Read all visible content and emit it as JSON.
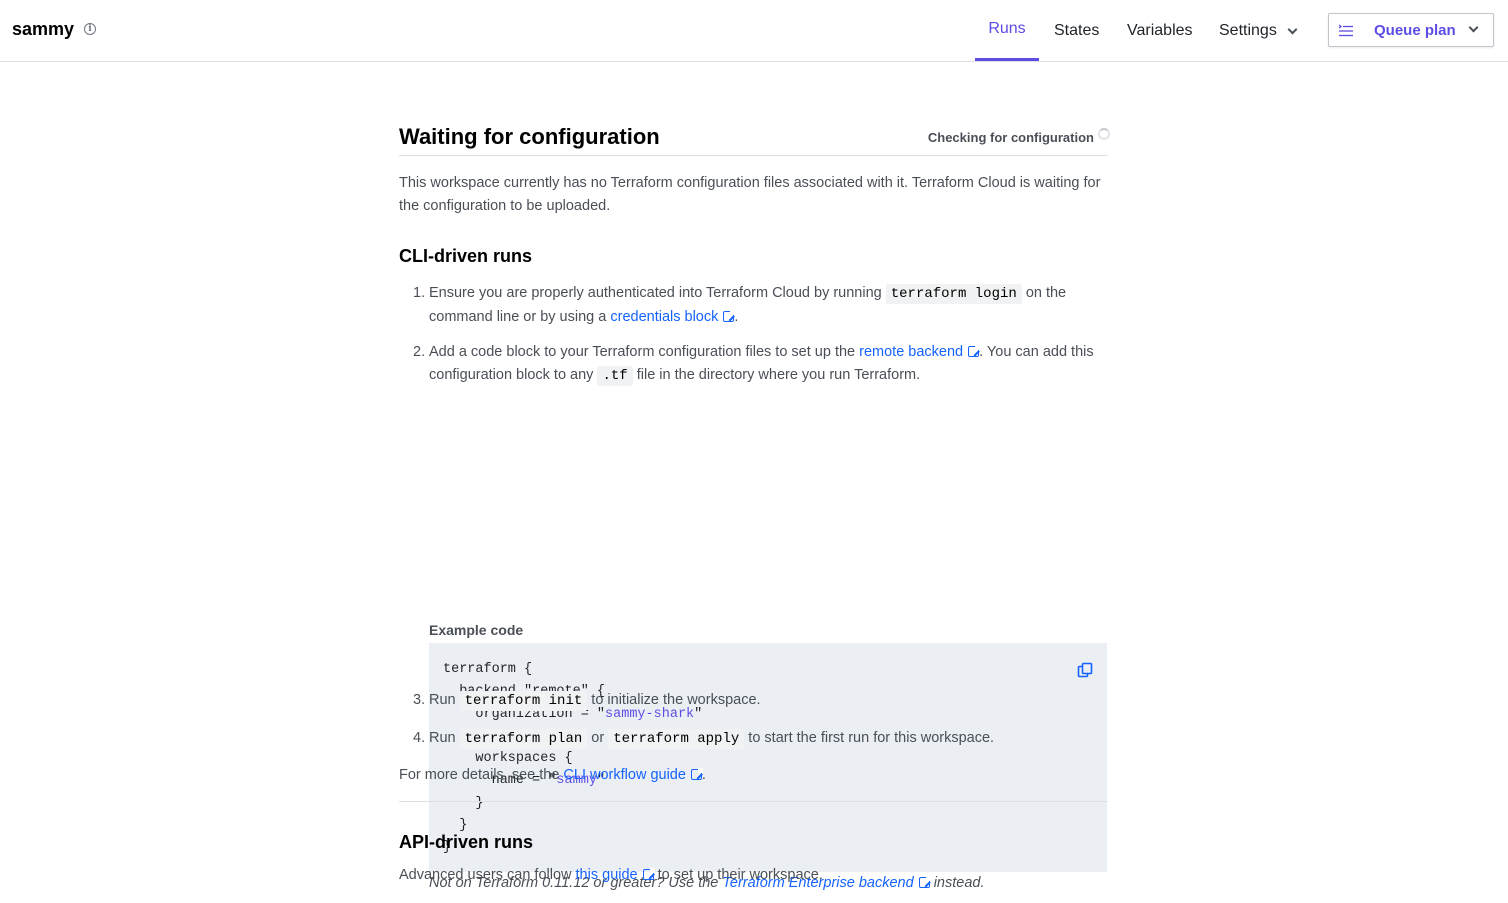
{
  "header": {
    "workspace_name": "sammy",
    "info_icon": "info-icon",
    "tabs": [
      {
        "label": "Runs",
        "active": true
      },
      {
        "label": "States"
      },
      {
        "label": "Variables"
      },
      {
        "label": "Settings"
      }
    ],
    "queue_button": "Queue plan"
  },
  "main": {
    "title": "Waiting for configuration",
    "status": "Checking for configuration",
    "intro": "This workspace currently has no Terraform configuration files associated with it. Terraform Cloud is waiting for the configuration to be uploaded.",
    "cli_heading": "CLI-driven runs",
    "steps": {
      "s1_num": "1.",
      "s1_a": "Ensure you are properly authenticated into Terraform Cloud by running",
      "s1_code": "terraform login",
      "s1_b": "on the command line or by using a",
      "s1_link": "credentials block",
      "s1_c": ".",
      "s2_num": "2.",
      "s2_a": "Add a code block to your Terraform configuration files to set up the",
      "s2_link": "remote backend",
      "s2_b": ". You can add this configuration block to any",
      "s2_code": ".tf",
      "s2_c": "file in the directory where you run Terraform.",
      "s3_num": "3.",
      "s3_a": "Run",
      "s3_code": "terraform init",
      "s3_b": "to initialize the workspace.",
      "s4_num": "4.",
      "s4_a": "Run",
      "s4_code1": "terraform plan",
      "s4_or": "or",
      "s4_code2": "terraform apply",
      "s4_b": "to start the first run for this workspace."
    },
    "example_label": "Example code",
    "code": {
      "l1": "terraform {",
      "l2": "  backend \"remote\" {",
      "l3_a": "    organization = \"",
      "l3_str": "sammy-shark",
      "l3_b": "\"",
      "l5": "    workspaces {",
      "l6_a": "      name = \"",
      "l6_str": "sammy",
      "l6_b": "\"",
      "l7": "    }",
      "l8": "  }",
      "l9": "}"
    },
    "note_a": "Not on Terraform 0.11.12 or greater? Use the",
    "note_link": "Terraform Enterprise backend",
    "note_b": "instead.",
    "more_a": "For more details, see the",
    "more_link": "CLI workflow guide",
    "more_b": ".",
    "api_heading": "API-driven runs",
    "api_a": "Advanced users can follow",
    "api_link": "this guide",
    "api_b": "to set up their workspace."
  },
  "colors": {
    "accent": "#5c4ee5",
    "link": "#1563ff",
    "code_bg": "#ebeef2"
  }
}
